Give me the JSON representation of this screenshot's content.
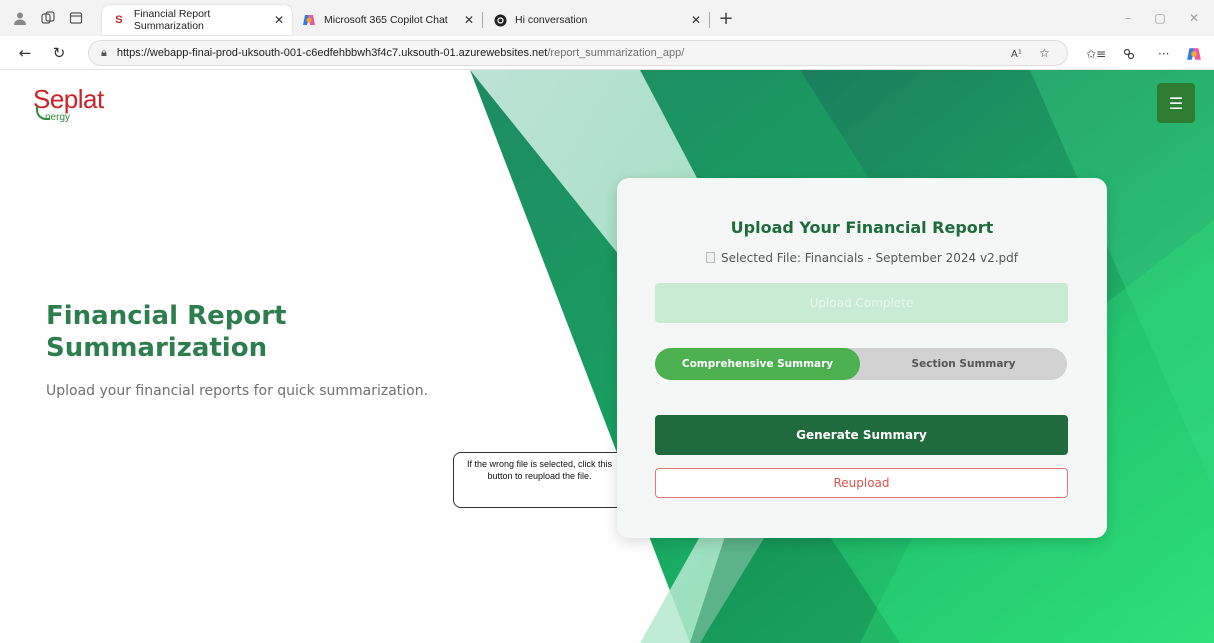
{
  "browser": {
    "tabs": [
      {
        "label": "Financial Report Summarization",
        "favicon": "S",
        "active": true
      },
      {
        "label": "Microsoft 365 Copilot Chat",
        "favicon": "copilot-icon",
        "active": false
      },
      {
        "label": "Hi conversation",
        "favicon": "chatgpt-icon",
        "active": false
      }
    ],
    "url_host": "https://webapp-finai-prod-uksouth-001-c6edfehbbwh3f4c7.uksouth-01.azurewebsites.net",
    "url_path": "/report_summarization_app/",
    "read_aloud": "A¹"
  },
  "page": {
    "logo_main": "Seplat",
    "logo_sub": "nergy",
    "hero_title": "Financial Report Summarization",
    "hero_subtitle": "Upload your financial reports for quick summarization.",
    "card": {
      "title": "Upload Your Financial Report",
      "selected_file": "Selected File: Financials - September 2024 v2.pdf",
      "upload_status": "Upload Complete",
      "toggle_options": [
        "Comprehensive Summary",
        "Section Summary"
      ],
      "generate_label": "Generate Summary",
      "reupload_label": "Reupload"
    },
    "callout_text": "If the wrong file is selected, click this button to reupload the file."
  },
  "colors": {
    "brand_green": "#2e7d32",
    "title_green": "#1e6b3e",
    "accent_green": "#4caf50",
    "logo_red": "#cc2229",
    "reupload_red": "#d9534f"
  }
}
